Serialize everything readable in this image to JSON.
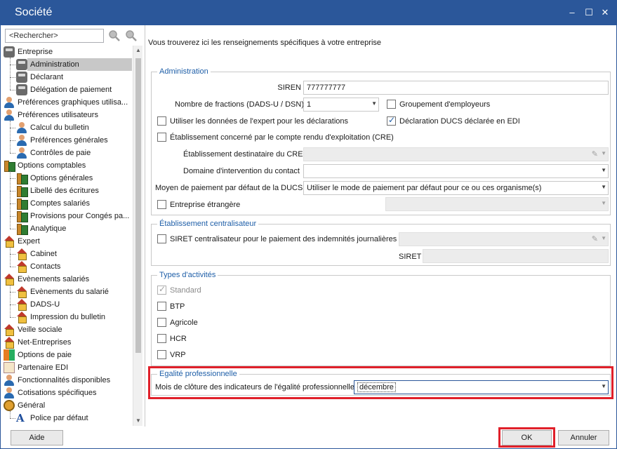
{
  "window": {
    "title": "Société",
    "controls": {
      "minimize": "‒",
      "maximize": "☐",
      "close": "✕"
    }
  },
  "search": {
    "placeholder": "<Rechercher>",
    "value": "<Rechercher>"
  },
  "tree": [
    {
      "label": "Entreprise",
      "level": 0,
      "icon": "database-icon"
    },
    {
      "label": "Administration",
      "level": 1,
      "icon": "database-icon",
      "selected": true
    },
    {
      "label": "Déclarant",
      "level": 1,
      "icon": "database-icon"
    },
    {
      "label": "Délégation de paiement",
      "level": 1,
      "icon": "database-icon"
    },
    {
      "label": "Préférences graphiques utilisa...",
      "level": 0,
      "icon": "user-icon"
    },
    {
      "label": "Préférences utilisateurs",
      "level": 0,
      "icon": "user-icon"
    },
    {
      "label": "Calcul du bulletin",
      "level": 1,
      "icon": "user-icon"
    },
    {
      "label": "Préférences générales",
      "level": 1,
      "icon": "user-icon"
    },
    {
      "label": "Contrôles de paie",
      "level": 1,
      "icon": "user-icon"
    },
    {
      "label": "Options comptables",
      "level": 0,
      "icon": "books-icon"
    },
    {
      "label": "Options générales",
      "level": 1,
      "icon": "books-icon"
    },
    {
      "label": "Libellé des écritures",
      "level": 1,
      "icon": "books-icon"
    },
    {
      "label": "Comptes salariés",
      "level": 1,
      "icon": "books-icon"
    },
    {
      "label": "Provisions pour Congés pa...",
      "level": 1,
      "icon": "books-icon"
    },
    {
      "label": "Analytique",
      "level": 1,
      "icon": "books-icon"
    },
    {
      "label": "Expert",
      "level": 0,
      "icon": "house-icon"
    },
    {
      "label": "Cabinet",
      "level": 1,
      "icon": "house-icon"
    },
    {
      "label": "Contacts",
      "level": 1,
      "icon": "house-icon"
    },
    {
      "label": "Evènements salariés",
      "level": 0,
      "icon": "house-icon"
    },
    {
      "label": "Evènements du salarié",
      "level": 1,
      "icon": "house-icon"
    },
    {
      "label": "DADS-U",
      "level": 1,
      "icon": "house-icon"
    },
    {
      "label": "Impression du bulletin",
      "level": 1,
      "icon": "house-icon"
    },
    {
      "label": "Veille sociale",
      "level": 0,
      "icon": "house-icon"
    },
    {
      "label": "Net-Entreprises",
      "level": 0,
      "icon": "house-icon"
    },
    {
      "label": "Options de paie",
      "level": 0,
      "icon": "grid-icon"
    },
    {
      "label": "Partenaire EDI",
      "level": 0,
      "icon": "edi-icon"
    },
    {
      "label": "Fonctionnalités disponibles",
      "level": 0,
      "icon": "user-icon"
    },
    {
      "label": "Cotisations spécifiques",
      "level": 0,
      "icon": "user-icon"
    },
    {
      "label": "Général",
      "level": 0,
      "icon": "gear-icon"
    },
    {
      "label": "Police par défaut",
      "level": 1,
      "icon": "font-icon"
    }
  ],
  "intro": "Vous trouverez ici les renseignements spécifiques à votre entreprise",
  "administration": {
    "title": "Administration",
    "siren_label": "SIREN",
    "siren_value": "777777777",
    "fractions_label": "Nombre de fractions (DADS-U / DSN)",
    "fractions_value": "1",
    "groupement_label": "Groupement d'employeurs",
    "groupement_checked": false,
    "expert_label": "Utiliser les données de l'expert pour les déclarations",
    "expert_checked": false,
    "ducs_edi_label": "Déclaration DUCS déclarée en EDI",
    "ducs_edi_checked": true,
    "cre_label": "Établissement concerné par le compte rendu d'exploitation (CRE)",
    "cre_checked": false,
    "cre_dest_label": "Établissement destinataire du CRE",
    "domaine_label": "Domaine d'intervention du contact",
    "paiement_label": "Moyen de paiement par défaut de la DUCS",
    "paiement_value": "Utiliser le mode de paiement par défaut pour ce ou ces organisme(s)",
    "etrangere_label": "Entreprise étrangère",
    "etrangere_checked": false
  },
  "centralisateur": {
    "title": "Établissement centralisateur",
    "siret_central_label": "SIRET centralisateur pour le paiement des indemnités journalières",
    "siret_central_checked": false,
    "siret_label": "SIRET"
  },
  "activites": {
    "title": "Types d'activités",
    "items": [
      {
        "label": "Standard",
        "checked": true,
        "disabled": true
      },
      {
        "label": "BTP",
        "checked": false
      },
      {
        "label": "Agricole",
        "checked": false
      },
      {
        "label": "HCR",
        "checked": false
      },
      {
        "label": "VRP",
        "checked": false
      }
    ]
  },
  "egalite": {
    "title": "Egalité professionnelle",
    "mois_label": "Mois de clôture des indicateurs de l'égalité professionnelle",
    "mois_value": "décembre"
  },
  "buttons": {
    "aide": "Aide",
    "ok": "OK",
    "annuler": "Annuler"
  },
  "colors": {
    "titlebar": "#2b579a",
    "group_title": "#1f5fa8",
    "highlight": "#e0202a",
    "selected_row": "#c8c8c8"
  }
}
